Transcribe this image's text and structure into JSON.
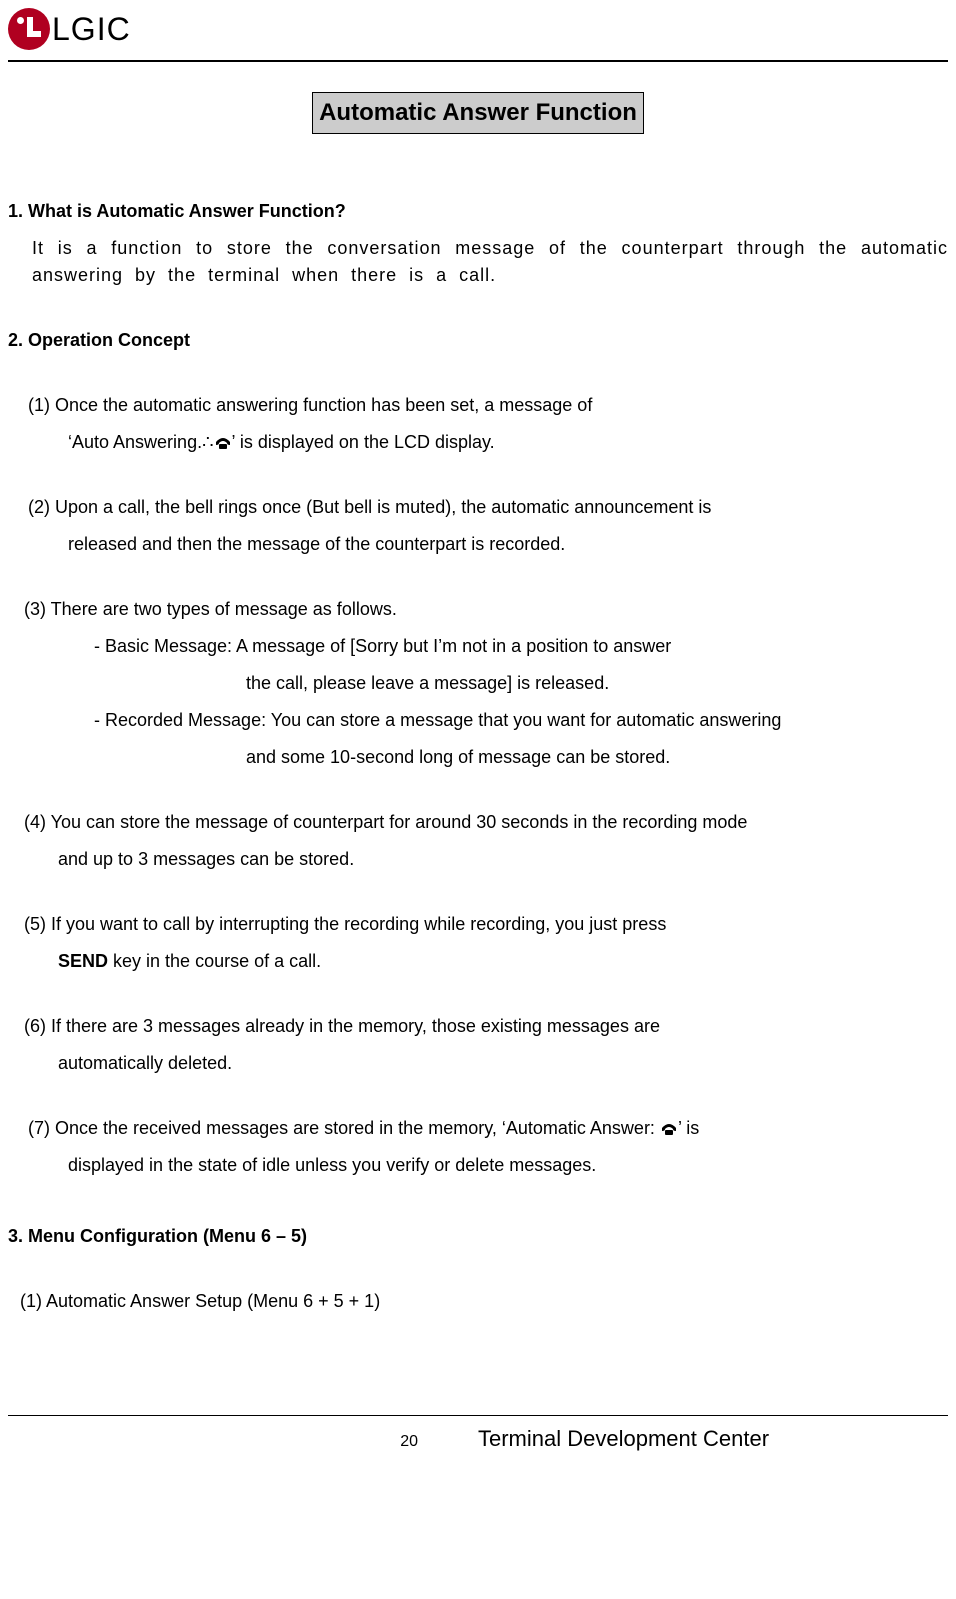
{
  "header": {
    "logo_label": "LG",
    "company": "LGIC"
  },
  "title": "Automatic Answer Function",
  "sections": {
    "s1": {
      "heading": "1. What is Automatic Answer Function?",
      "body": "It is a function to store the conversation message of the counterpart through the automatic answering by the terminal when there is a call."
    },
    "s2": {
      "heading": "2. Operation Concept",
      "i1_a": "(1) Once the automatic answering function has been set, a message of",
      "i1_b_pre": "‘Auto Answering.∴",
      "i1_b_post": "’ is displayed on the LCD display.",
      "i2_a": "(2) Upon a call, the bell rings once (But bell is muted), the automatic announcement is",
      "i2_b": "released and then the message of the counterpart is recorded.",
      "i3_a": "(3) There are two types of message as follows.",
      "i3_b": "- Basic Message: A message of [Sorry but I’m not in a position to answer",
      "i3_c": "the call, please leave a message] is released.",
      "i3_d": "- Recorded Message: You can store a message that you want for automatic answering",
      "i3_e": "and some 10-second long of message can be stored.",
      "i4_a": "(4) You can store the message of counterpart for around 30 seconds in the recording mode",
      "i4_b": "and up to 3 messages can be stored.",
      "i5_a": "(5) If you want to call by interrupting the recording while recording, you just press",
      "i5_b_bold": "SEND",
      "i5_b_rest": " key in the course of a call.",
      "i6_a": "(6) If there are 3 messages already in the memory, those existing messages are",
      "i6_b": "automatically deleted.",
      "i7_a_pre": "(7) Once the received messages are stored in the memory, ‘Automatic Answer: ",
      "i7_a_post": "’ is",
      "i7_b": "displayed in the state of idle unless you verify or delete messages."
    },
    "s3": {
      "heading": "3. Menu Configuration (Menu 6 – 5)",
      "i1": "(1)   Automatic Answer Setup (Menu 6 + 5 + 1)"
    }
  },
  "footer": {
    "page_number": "20",
    "org": "Terminal Development Center"
  },
  "icons": {
    "phone": "phone-icon"
  }
}
